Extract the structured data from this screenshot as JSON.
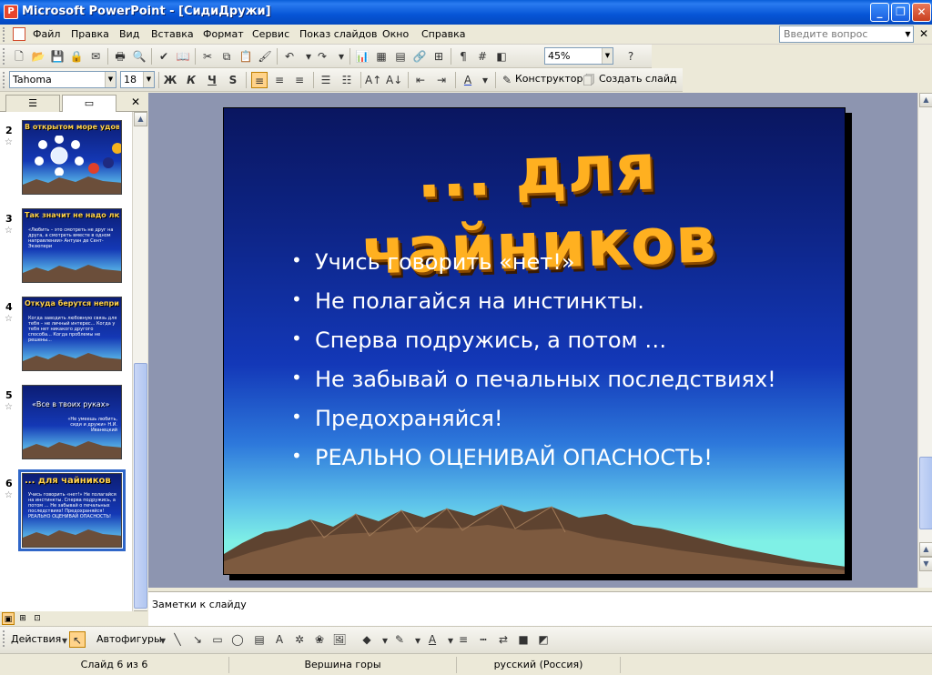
{
  "window": {
    "title": "Microsoft PowerPoint - [СидиДружи]",
    "min": "_",
    "max": "❐",
    "close": "✕"
  },
  "menu": {
    "items": [
      "Файл",
      "Правка",
      "Вид",
      "Вставка",
      "Формат",
      "Сервис",
      "Показ слайдов",
      "Окно",
      "Справка"
    ],
    "help_placeholder": "Введите вопрос"
  },
  "toolbar_standard": {
    "zoom": "45%"
  },
  "toolbar_format": {
    "font": "Tahoma",
    "size": "18",
    "bold": "Ж",
    "italic": "К",
    "underline": "Ч",
    "shadow": "S",
    "designer": "Конструктор",
    "new_slide": "Создать слайд"
  },
  "slides_panel": {
    "thumbnails": [
      {
        "num": "2",
        "title": "В открытом море удовольствий...",
        "body": ""
      },
      {
        "num": "3",
        "title": "Так значит не надо любить?",
        "body": "«Любить – это смотреть не друг на друга, а смотреть вместе в одном направлении» Антуан де Сент-Экзюпери"
      },
      {
        "num": "4",
        "title": "Откуда берутся неприятности?",
        "body": "Когда заводить любовную связь для тебя – не личный интерес... Когда у тебя нет никакого другого способа... Когда проблемы не решены..."
      },
      {
        "num": "5",
        "title": "«Все в твоих руках»",
        "body": "«Не умеешь любить, сиди и дружи» Н.И. Иванецкий"
      },
      {
        "num": "6",
        "title": "... для чайников",
        "body": "Учись говорить «нет!» Не полагайся на инстинкты. Сперва подружись, а потом … Не забывай о печальных последствиях! Предохраняйся! РЕАЛЬНО ОЦЕНИВАЙ ОПАСНОСТЬ!"
      }
    ]
  },
  "slide": {
    "title": "... для чайников",
    "bullets": [
      "Учись говорить «нет!»",
      "Не полагайся на инстинкты.",
      "Сперва подружись, а потом …",
      "Не забывай о печальных последствиях!",
      "Предохраняйся!",
      "РЕАЛЬНО ОЦЕНИВАЙ ОПАСНОСТЬ!"
    ]
  },
  "notes": {
    "placeholder": "Заметки к слайду"
  },
  "draw_toolbar": {
    "actions": "Действия",
    "autoshapes": "Автофигуры"
  },
  "status": {
    "slide": "Слайд 6 из 6",
    "design": "Вершина горы",
    "language": "русский (Россия)"
  }
}
